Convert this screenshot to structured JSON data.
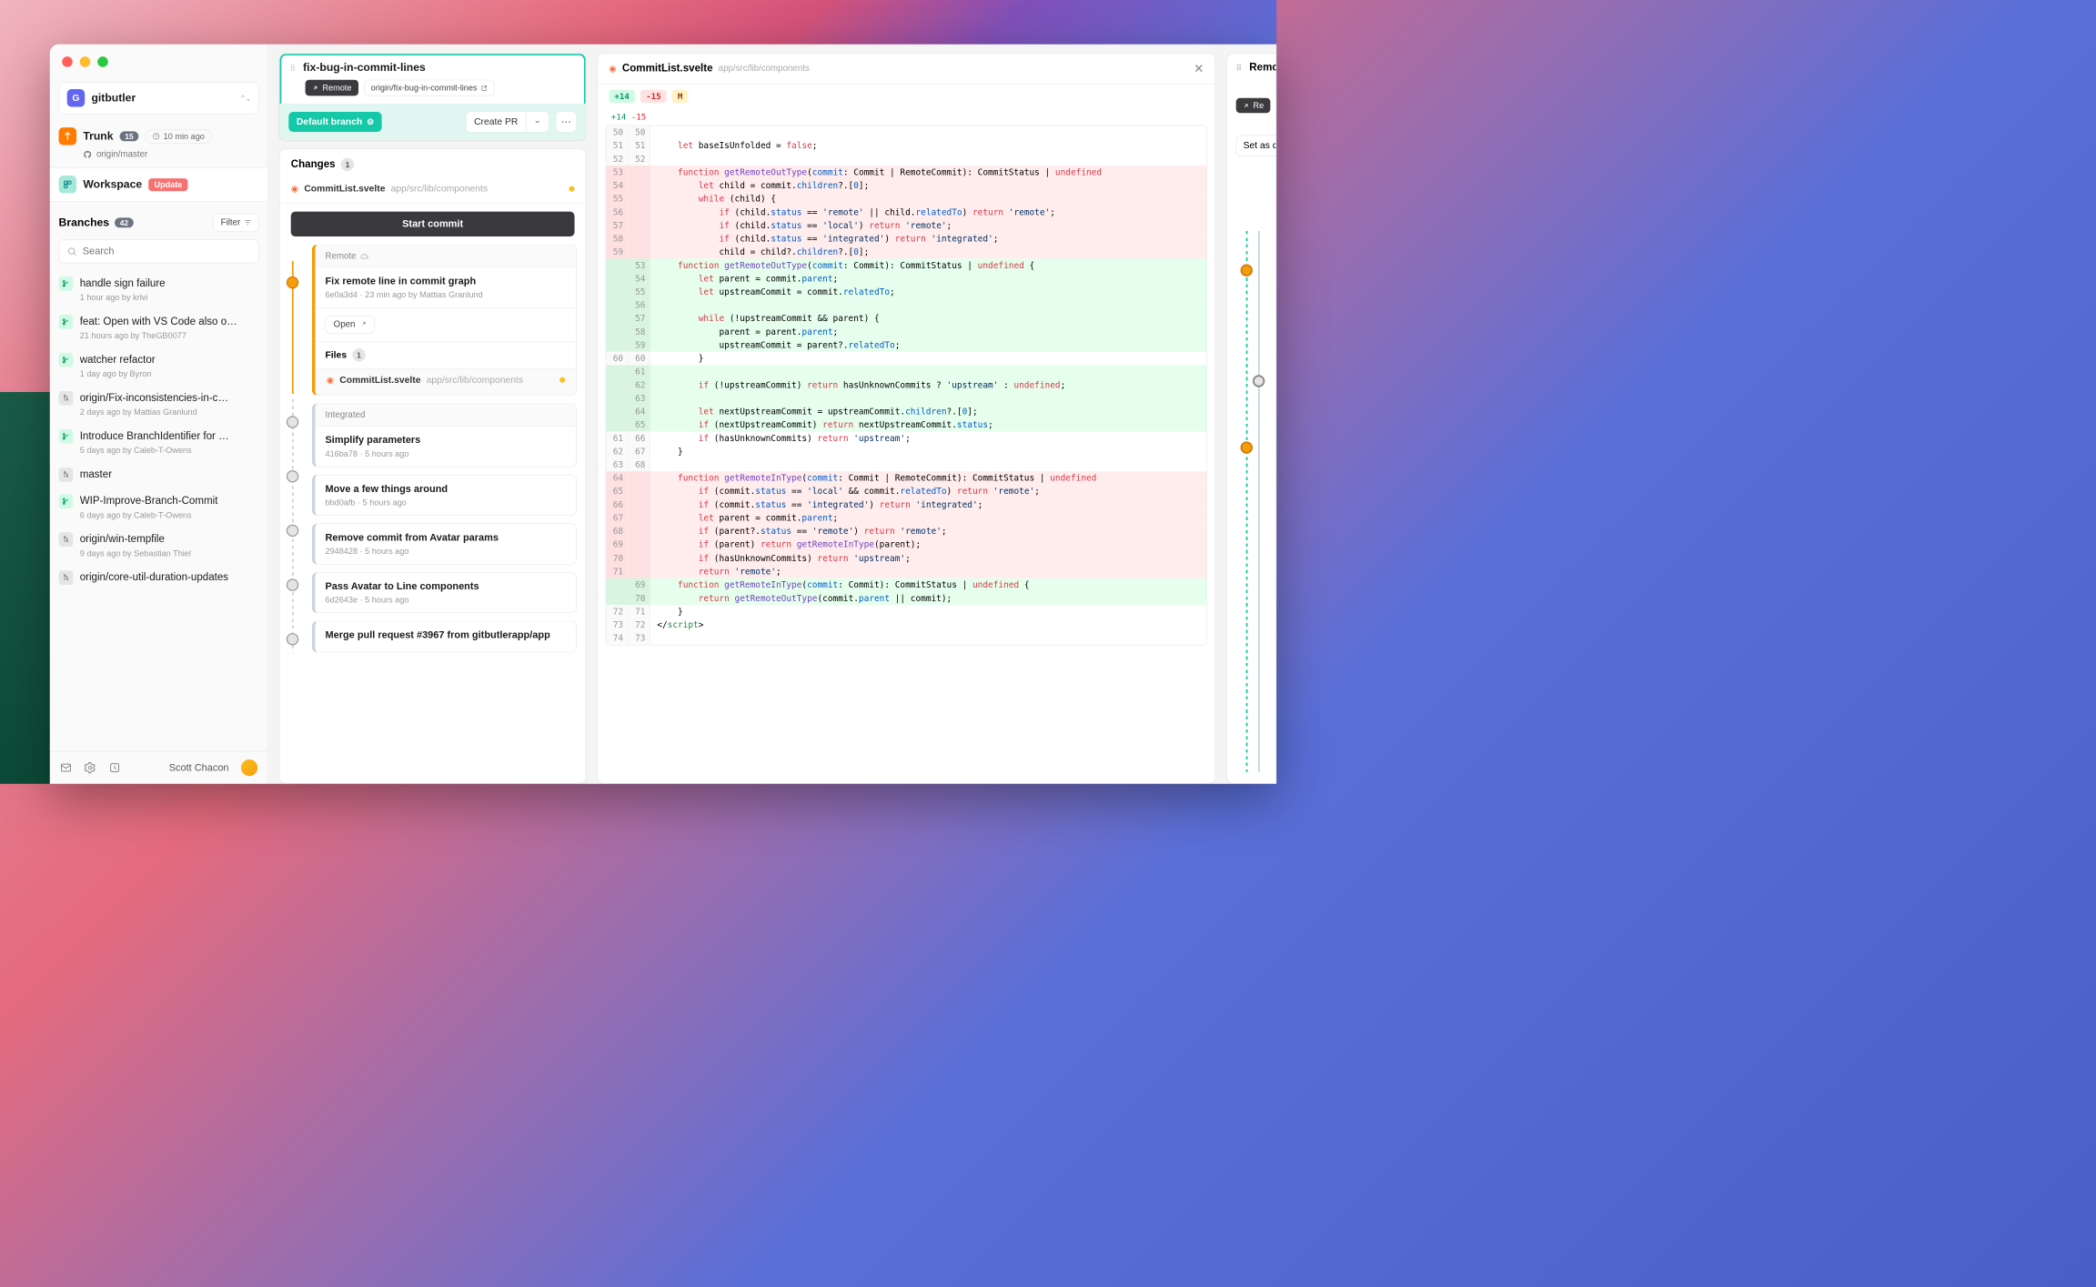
{
  "repo": {
    "initial": "G",
    "name": "gitbutler"
  },
  "nav": {
    "trunk": {
      "label": "Trunk",
      "count": "15",
      "time": "10 min ago",
      "remote": "origin/master"
    },
    "workspace": {
      "label": "Workspace",
      "update": "Update"
    }
  },
  "branches": {
    "title": "Branches",
    "count": "42",
    "filter": "Filter",
    "search_placeholder": "Search",
    "items": [
      {
        "name": "handle sign failure",
        "meta": "1 hour ago by krlvi",
        "icon": "green"
      },
      {
        "name": "feat: Open with VS Code also o…",
        "meta": "21 hours ago by TheGB0077",
        "icon": "green"
      },
      {
        "name": "watcher refactor",
        "meta": "1 day ago by Byron",
        "icon": "green"
      },
      {
        "name": "origin/Fix-inconsistencies-in-c…",
        "meta": "2 days ago by Mattias Granlund",
        "icon": "gray"
      },
      {
        "name": "Introduce BranchIdentifier for …",
        "meta": "5 days ago by Caleb-T-Owens",
        "icon": "green"
      },
      {
        "name": "master",
        "meta": "",
        "icon": "gray"
      },
      {
        "name": "WIP-Improve-Branch-Commit",
        "meta": "6 days ago by Caleb-T-Owens",
        "icon": "green"
      },
      {
        "name": "origin/win-tempfile",
        "meta": "9 days ago by Sebastian Thiel",
        "icon": "gray"
      },
      {
        "name": "origin/core-util-duration-updates",
        "meta": "",
        "icon": "gray"
      }
    ]
  },
  "user": {
    "name": "Scott Chacon"
  },
  "lane": {
    "title": "fix-bug-in-commit-lines",
    "remote_pill": "Remote",
    "origin_pill": "origin/fix-bug-in-commit-lines",
    "default_branch": "Default branch",
    "create_pr": "Create PR",
    "changes_title": "Changes",
    "changes_count": "1",
    "file_name": "CommitList.svelte",
    "file_path": "app/src/lib/components",
    "start_commit": "Start commit",
    "remote_section": "Remote",
    "remote_commit": {
      "title": "Fix remote line in commit graph",
      "meta": "6e0a3d4 · 23 min ago by Mattias Granlund",
      "open": "Open",
      "files_title": "Files",
      "files_count": "1",
      "file_name": "CommitList.svelte",
      "file_path": "app/src/lib/components"
    },
    "integrated_section": "Integrated",
    "commits": [
      {
        "title": "Simplify parameters",
        "meta": "416ba78 · 5 hours ago"
      },
      {
        "title": "Move a few things around",
        "meta": "bbd0afb · 5 hours ago"
      },
      {
        "title": "Remove commit from Avatar params",
        "meta": "2948428 · 5 hours ago"
      },
      {
        "title": "Pass Avatar to Line components",
        "meta": "6d2643e · 5 hours ago"
      },
      {
        "title": "Merge pull request #3967 from gitbutlerapp/app",
        "meta": ""
      }
    ]
  },
  "diff": {
    "file_name": "CommitList.svelte",
    "file_path": "app/src/lib/components",
    "add": "+14",
    "del": "-15",
    "mod": "M",
    "summary_add": "+14",
    "summary_del": "-15"
  },
  "right": {
    "title": "Remo",
    "pill": "Re",
    "setas": "Set as d"
  }
}
